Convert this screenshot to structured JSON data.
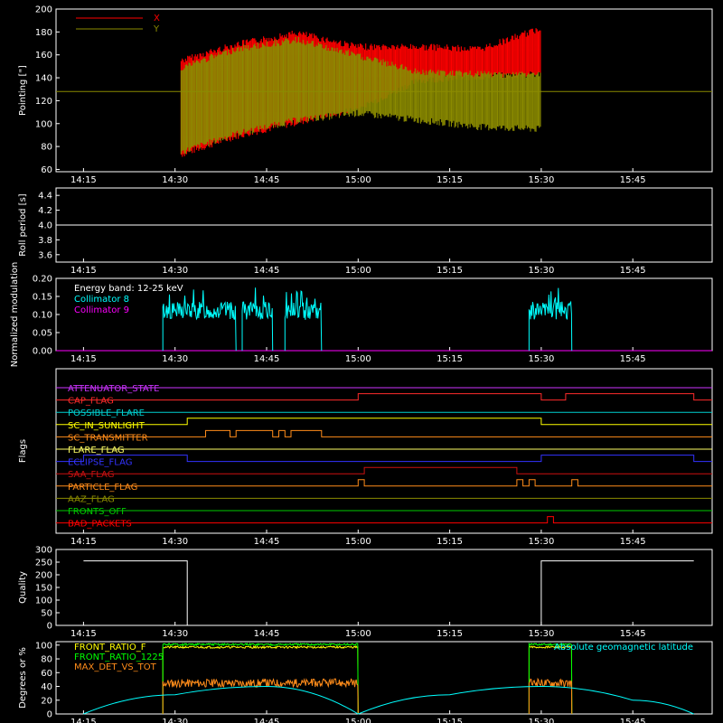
{
  "chart_data": [
    {
      "type": "line",
      "ylabel": "Pointing [\"]",
      "ylim": [
        58,
        200
      ],
      "yticks": [
        60,
        80,
        100,
        120,
        140,
        160,
        180,
        200
      ],
      "xticks": [
        "14:15",
        "14:30",
        "14:45",
        "15:00",
        "15:15",
        "15:30",
        "15:45"
      ],
      "legend": [
        {
          "name": "X",
          "color": "#ff0000"
        },
        {
          "name": "Y",
          "color": "#8b8b00"
        }
      ],
      "reference_line": 128,
      "series": [
        {
          "name": "X",
          "color": "#ff0000",
          "x_start": "14:31",
          "x_end": "15:30",
          "points": [
            [
              "14:31",
              150
            ],
            [
              "14:40",
              170
            ],
            [
              "14:50",
              178
            ],
            [
              "15:00",
              165
            ],
            [
              "15:10",
              160
            ],
            [
              "15:20",
              158
            ],
            [
              "15:30",
              158
            ]
          ],
          "band": [
            [
              "14:31",
              70,
              158
            ],
            [
              "14:40",
              86,
              172
            ],
            [
              "14:50",
              98,
              182
            ],
            [
              "15:00",
              110,
              170
            ],
            [
              "15:10",
              135,
              170
            ],
            [
              "15:20",
              138,
              168
            ],
            [
              "15:30",
              140,
              186
            ]
          ]
        },
        {
          "name": "Y",
          "color": "#8b8b00",
          "x_start": "14:31",
          "x_end": "15:30",
          "band": [
            [
              "14:31",
              72,
              152
            ],
            [
              "14:40",
              88,
              168
            ],
            [
              "14:50",
              100,
              176
            ],
            [
              "15:00",
              106,
              162
            ],
            [
              "15:10",
              100,
              148
            ],
            [
              "15:20",
              94,
              146
            ],
            [
              "15:30",
              92,
              146
            ]
          ]
        }
      ]
    },
    {
      "type": "line",
      "ylabel": "Roll period [s]",
      "ylim": [
        3.5,
        4.5
      ],
      "yticks": [
        "3.6",
        "3.8",
        "4.0",
        "4.2",
        "4.4"
      ],
      "xticks": [
        "14:15",
        "14:30",
        "14:45",
        "15:00",
        "15:15",
        "15:30",
        "15:45"
      ],
      "series": [
        {
          "name": "",
          "color": "#ffffff",
          "y": 4.0
        }
      ]
    },
    {
      "type": "line",
      "ylabel": "Normalized modulation",
      "ylim": [
        0,
        0.2
      ],
      "yticks": [
        "0.00",
        "0.05",
        "0.10",
        "0.15",
        "0.20"
      ],
      "xticks": [
        "14:15",
        "14:30",
        "14:45",
        "15:00",
        "15:15",
        "15:30",
        "15:45"
      ],
      "legend_title": "Energy band: 12-25 keV",
      "legend": [
        {
          "name": "Collimator 8",
          "color": "#00ffff"
        },
        {
          "name": "Collimator 9",
          "color": "#ff00ff"
        }
      ],
      "segments": [
        [
          "14:28",
          "14:40",
          0.11
        ],
        [
          "14:41",
          "14:46",
          0.11
        ],
        [
          "14:48",
          "14:54",
          0.11
        ],
        [
          "15:28",
          "15:35",
          0.11
        ]
      ]
    },
    {
      "type": "line",
      "ylabel": "Flags",
      "xticks": [
        "14:15",
        "14:30",
        "14:45",
        "15:00",
        "15:15",
        "15:30",
        "15:45"
      ],
      "flags": [
        {
          "name": "ATTENUATOR_STATE",
          "color": "#cc33ff",
          "steps": []
        },
        {
          "name": "CAP_FLAG",
          "color": "#ff2b2b",
          "steps": [
            [
              "15:00",
              "15:30"
            ],
            [
              "15:34",
              "15:55"
            ]
          ]
        },
        {
          "name": "POSSIBLE_FLARE",
          "color": "#00d0d0",
          "steps": []
        },
        {
          "name": "SC_IN_SUNLIGHT",
          "color": "#ffff00",
          "steps": [
            [
              "14:32",
              "15:30"
            ]
          ]
        },
        {
          "name": "SC_TRANSMITTER",
          "color": "#ff8c1a",
          "steps": [
            [
              "14:35",
              "14:39"
            ],
            [
              "14:40",
              "14:46"
            ],
            [
              "14:47",
              "14:48"
            ],
            [
              "14:49",
              "14:54"
            ]
          ]
        },
        {
          "name": "FLARE_FLAG",
          "color": "#ffff66",
          "steps": []
        },
        {
          "name": "ECLIPSE_FLAG",
          "color": "#3333ff",
          "steps": [
            [
              "14:15",
              "14:32"
            ],
            [
              "15:30",
              "15:55"
            ]
          ]
        },
        {
          "name": "SAA_FLAG",
          "color": "#cc1111",
          "steps": [
            [
              "15:01",
              "15:26"
            ]
          ]
        },
        {
          "name": "PARTICLE_FLAG",
          "color": "#ff8c1a",
          "steps": [
            [
              "15:00",
              "15:01"
            ],
            [
              "15:26",
              "15:27"
            ],
            [
              "15:28",
              "15:29"
            ],
            [
              "15:35",
              "15:36"
            ]
          ]
        },
        {
          "name": "AAZ_FLAG",
          "color": "#8b8b00",
          "steps": []
        },
        {
          "name": "FRONTS_OFF",
          "color": "#00cc00",
          "steps": []
        },
        {
          "name": "BAD_PACKETS",
          "color": "#ff0000",
          "steps": [
            [
              "15:31",
              "15:32"
            ]
          ]
        }
      ]
    },
    {
      "type": "line",
      "ylabel": "Quality",
      "ylim": [
        0,
        300
      ],
      "yticks": [
        "0",
        "50",
        "100",
        "150",
        "200",
        "250",
        "300"
      ],
      "xticks": [
        "14:15",
        "14:30",
        "14:45",
        "15:00",
        "15:15",
        "15:30",
        "15:45"
      ],
      "series": [
        {
          "name": "",
          "color": "#ffffff",
          "points": [
            [
              "14:15",
              255
            ],
            [
              "14:32",
              255
            ],
            [
              "14:32",
              0
            ],
            [
              "15:30",
              0
            ],
            [
              "15:30",
              255
            ],
            [
              "15:55",
              255
            ]
          ]
        }
      ]
    },
    {
      "type": "line",
      "ylabel": "Degrees or %",
      "ylim": [
        0,
        105
      ],
      "yticks": [
        "0",
        "20",
        "40",
        "60",
        "80",
        "100"
      ],
      "xticks": [
        "14:15",
        "14:30",
        "14:45",
        "15:00",
        "15:15",
        "15:30",
        "15:45"
      ],
      "legend": [
        {
          "name": "FRONT_RATIO_F",
          "color": "#ffff00"
        },
        {
          "name": "FRONT_RATIO_1225",
          "color": "#00ff00"
        },
        {
          "name": "MAX_DET_VS_TOT",
          "color": "#ff8c1a"
        }
      ],
      "legend_right": {
        "name": "Absolute geomagnetic latitude",
        "color": "#00ffff"
      },
      "series": [
        {
          "name": "FRONT_RATIO_F",
          "color": "#ffff00",
          "segments": [
            [
              "14:28",
              "15:00",
              97
            ],
            [
              "15:28",
              "15:35",
              97
            ]
          ]
        },
        {
          "name": "FRONT_RATIO_1225",
          "color": "#00ff00",
          "segments": [
            [
              "14:28",
              "15:00",
              101
            ],
            [
              "15:28",
              "15:35",
              101
            ]
          ]
        },
        {
          "name": "MAX_DET_VS_TOT",
          "color": "#ff8c1a",
          "segments": [
            [
              "14:28",
              "15:00",
              45
            ],
            [
              "15:28",
              "15:35",
              45
            ]
          ]
        },
        {
          "name": "Absolute geomagnetic latitude",
          "color": "#00ffff",
          "points": [
            [
              "14:15",
              0
            ],
            [
              "14:30",
              28
            ],
            [
              "14:45",
              40
            ],
            [
              "15:00",
              0
            ],
            [
              "15:15",
              28
            ],
            [
              "15:30",
              40
            ],
            [
              "15:45",
              20
            ],
            [
              "15:55",
              0
            ]
          ]
        }
      ]
    }
  ]
}
